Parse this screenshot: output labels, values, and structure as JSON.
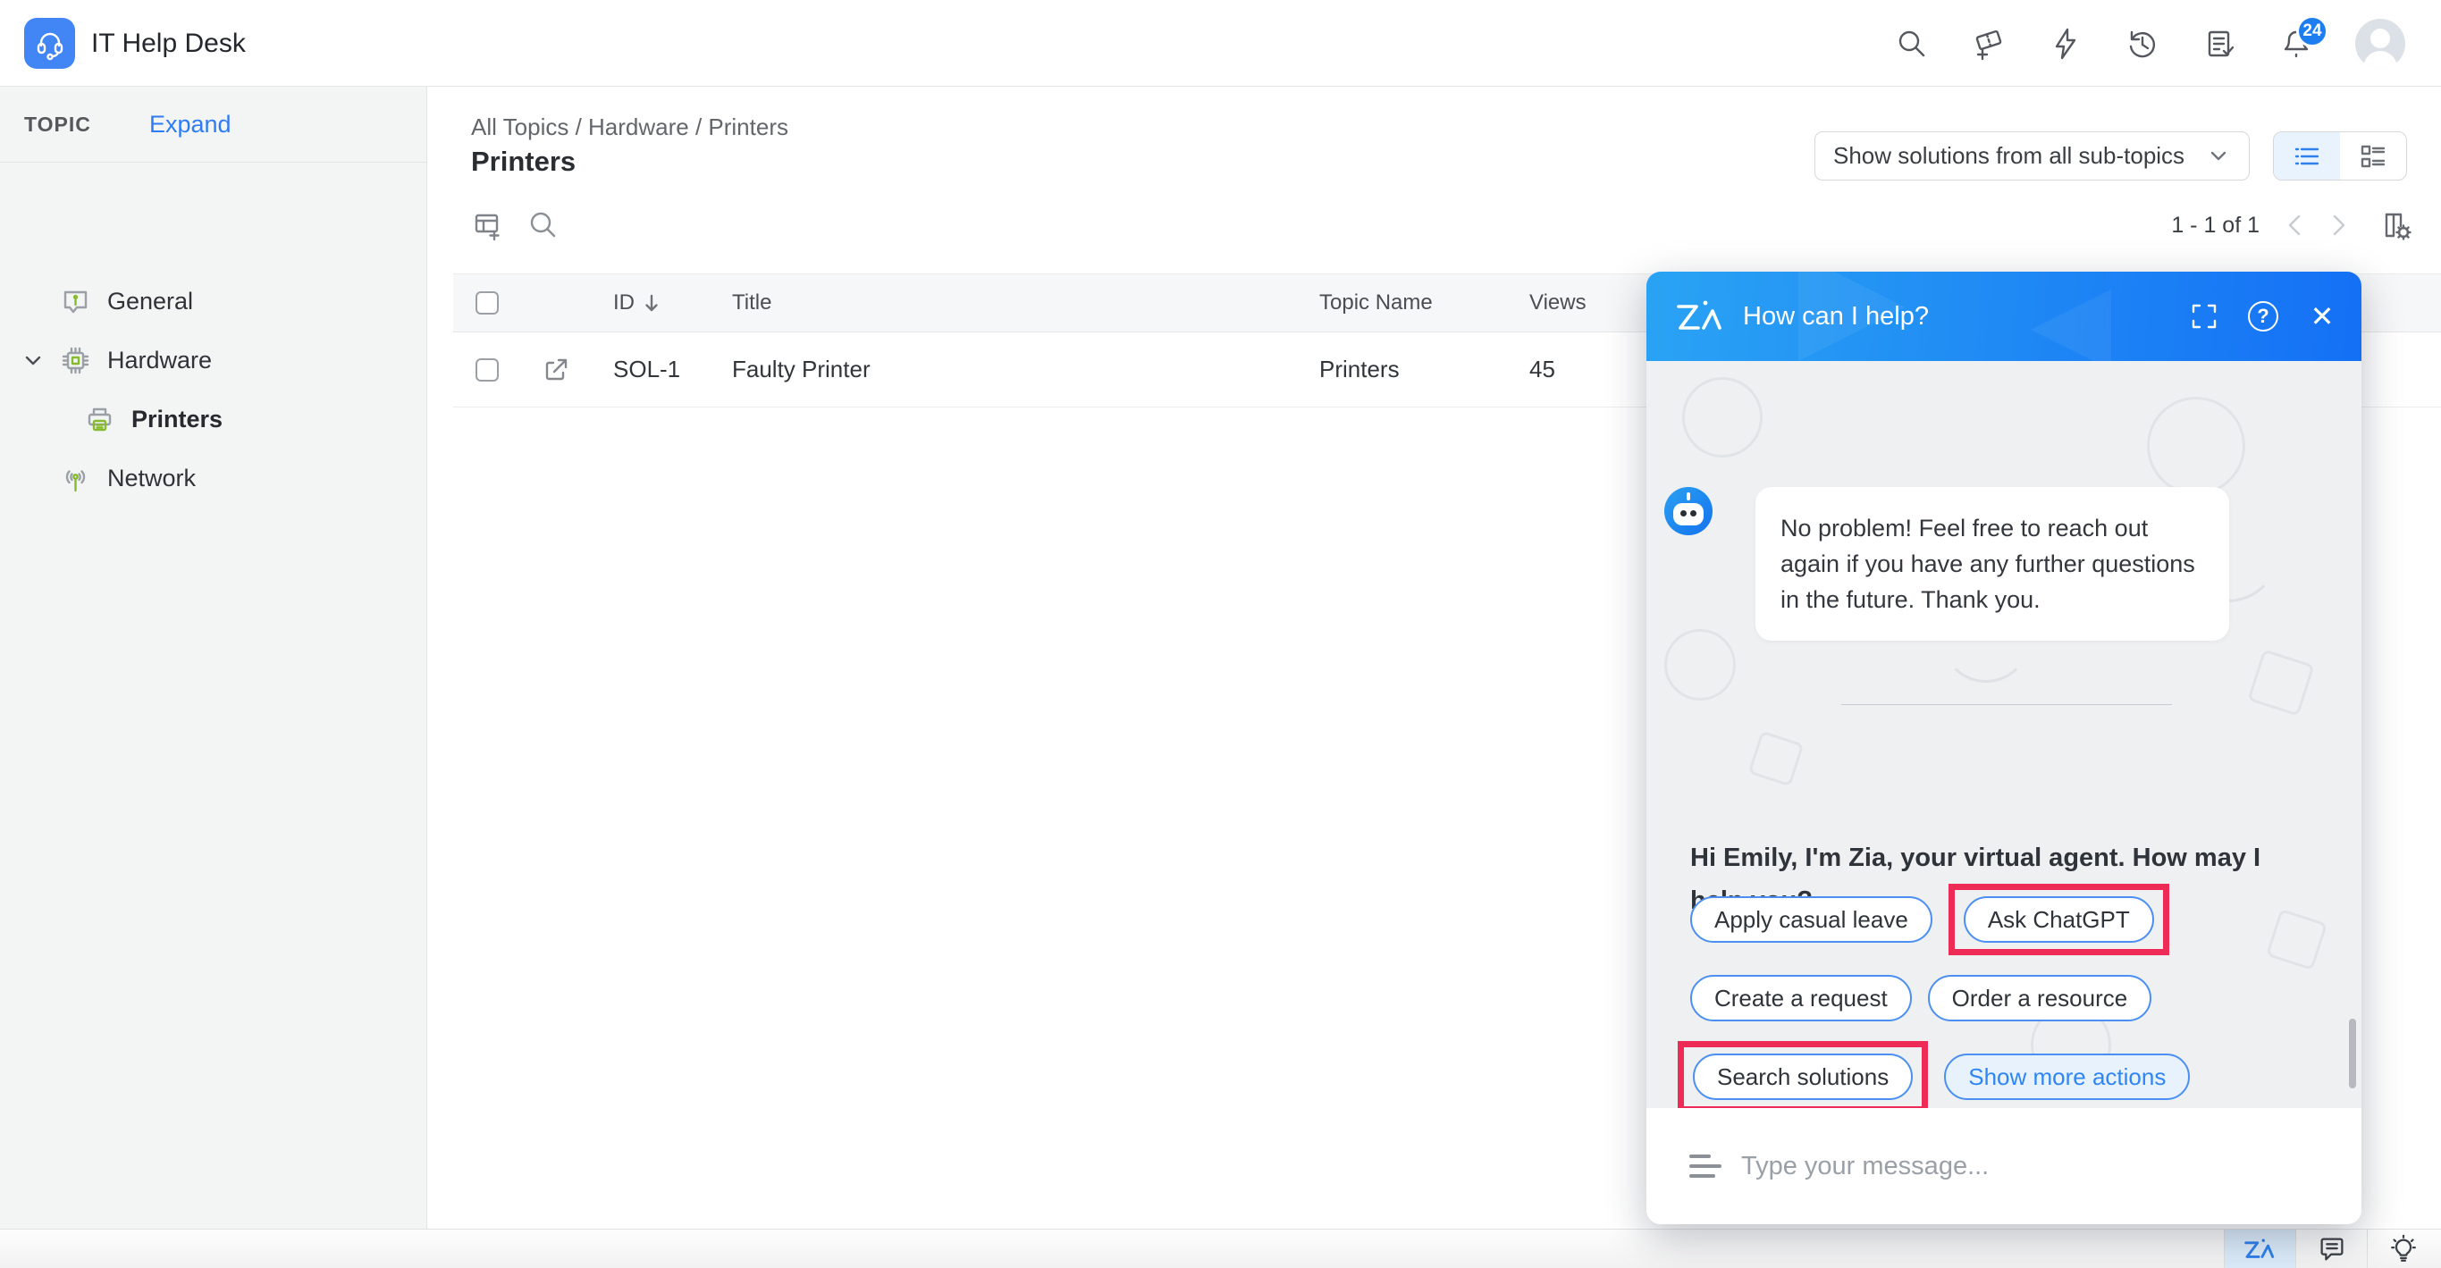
{
  "header": {
    "app_title": "IT Help Desk",
    "notification_badge": "24"
  },
  "sidebar": {
    "panel_label": "TOPIC",
    "expand_label": "Expand",
    "items": [
      {
        "label": "General"
      },
      {
        "label": "Hardware"
      },
      {
        "label": "Printers"
      },
      {
        "label": "Network"
      }
    ]
  },
  "main": {
    "breadcrumb": "All Topics / Hardware / Printers",
    "page_title": "Printers",
    "filter_selected": "Show solutions from all sub-topics",
    "pagination": "1 - 1 of 1",
    "table": {
      "columns": {
        "id": "ID",
        "title": "Title",
        "topic": "Topic Name",
        "views": "Views"
      },
      "rows": [
        {
          "id": "SOL-1",
          "title": "Faulty Printer",
          "topic": "Printers",
          "views": "45"
        }
      ]
    }
  },
  "chat": {
    "title": "How can I help?",
    "bot_message": "No problem! Feel free to reach out again if you have any further questions in the future. Thank you.",
    "greeting": "Hi Emily, I'm Zia, your virtual agent. How may I help you?",
    "actions": {
      "apply_leave": "Apply casual leave",
      "ask_chatgpt": "Ask ChatGPT",
      "create_request": "Create a request",
      "order_resource": "Order a resource",
      "search_solutions": "Search solutions",
      "show_more": "Show more actions"
    },
    "input_placeholder": "Type your message..."
  },
  "colors": {
    "accent_blue": "#2f80ed",
    "chat_gradient_start": "#2aa3f4",
    "chat_gradient_end": "#1470f5",
    "highlight_red": "#ee2b57",
    "brand_green": "#86bb2d"
  }
}
